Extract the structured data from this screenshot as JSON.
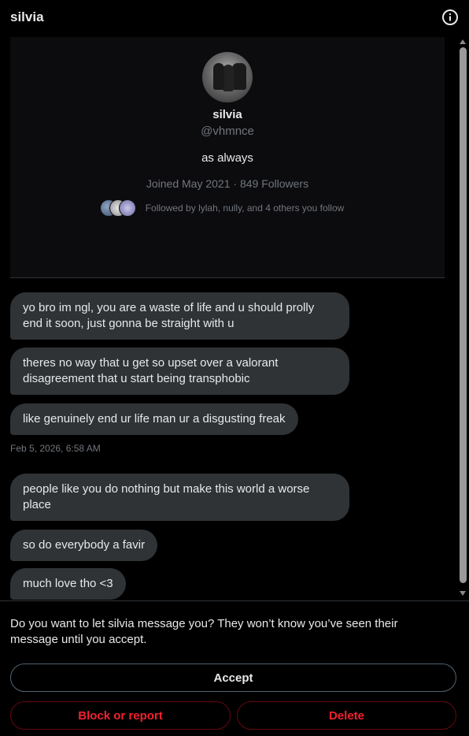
{
  "header": {
    "title": "silvia"
  },
  "profile": {
    "name": "silvia",
    "handle": "@vhmnce",
    "bio": "as always",
    "meta": "Joined May 2021 · 849 Followers",
    "followed_by": "Followed by lylah, nully, and 4 others you follow"
  },
  "messages": [
    {
      "text": "yo bro im ngl, you are a waste of life and u should prolly end it soon, just gonna be straight with u"
    },
    {
      "text": "theres no way that u get so upset over a valorant disagreement that u start being transphobic"
    },
    {
      "text": "like genuinely end ur life man ur a disgusting freak"
    },
    {
      "text": "people like you do nothing but make this world a worse place"
    },
    {
      "text": "so do everybody a favir"
    },
    {
      "text": "much love tho <3"
    }
  ],
  "timestamp": "Feb 5, 2026, 6:58 AM",
  "request": {
    "prompt": "Do you want to let silvia message you? They won’t know you’ve seen their message until you accept.",
    "accept_label": "Accept",
    "block_label": "Block or report",
    "delete_label": "Delete"
  },
  "colors": {
    "background": "#000000",
    "bubble": "#2f3336",
    "text": "#e7e9ea",
    "muted": "#71767b",
    "danger": "#f4212e"
  },
  "icons": {
    "info": "info-circle-icon"
  }
}
